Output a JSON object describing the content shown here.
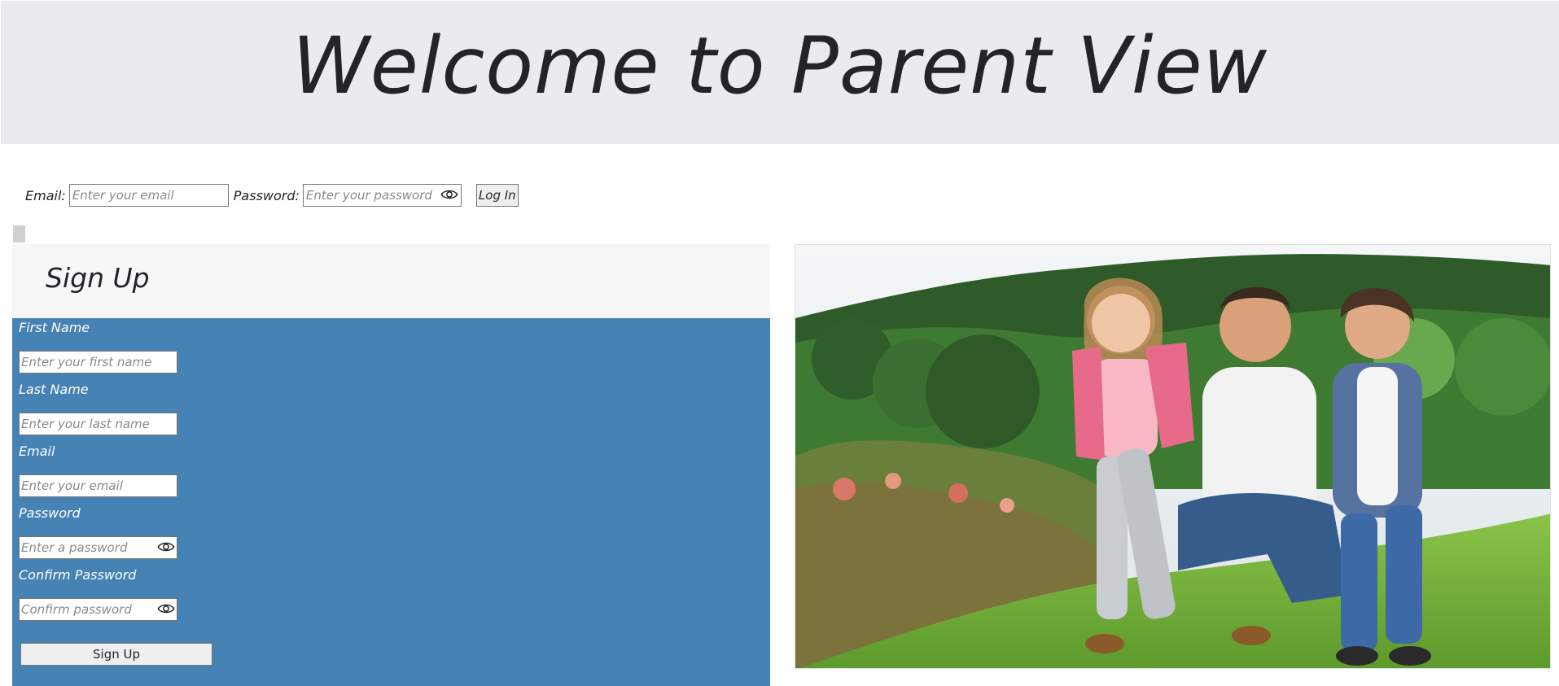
{
  "header": {
    "title": "Welcome to Parent View"
  },
  "login": {
    "email_label": "Email:",
    "email_placeholder": "Enter your email",
    "password_label": "Password:",
    "password_placeholder": "Enter your password",
    "login_button": "Log In",
    "toggle_icon": "eye-icon"
  },
  "signup": {
    "title": "Sign Up",
    "fields": {
      "first_name_label": "First Name",
      "first_name_placeholder": "Enter your first name",
      "last_name_label": "Last Name",
      "last_name_placeholder": "Enter your last name",
      "email_label": "Email",
      "email_placeholder": "Enter your email",
      "password_label": "Password",
      "password_placeholder": "Enter a password",
      "confirm_label": "Confirm Password",
      "confirm_placeholder": "Confirm password"
    },
    "submit_button": "Sign Up",
    "background_color": "#4682b4"
  },
  "photo": {
    "icon": "family-photo"
  }
}
